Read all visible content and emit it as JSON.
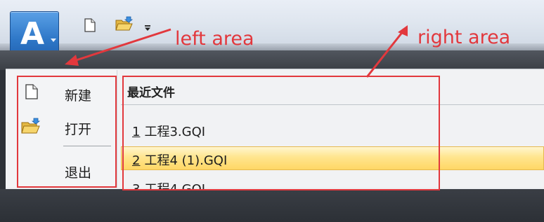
{
  "app": {
    "button_letter": "A"
  },
  "quick_access": {
    "icons": [
      "new-document-icon",
      "open-folder-icon",
      "customize-dropdown-icon"
    ]
  },
  "menu": {
    "items": [
      {
        "label": "新建",
        "icon": "new-document-icon"
      },
      {
        "label": "打开",
        "icon": "open-folder-icon"
      },
      {
        "label": "退出",
        "icon": ""
      }
    ]
  },
  "recent": {
    "header": "最近文件",
    "items": [
      {
        "num": "1",
        "name": "工程3.GQI",
        "selected": false
      },
      {
        "num": "2",
        "name": "工程4 (1).GQI",
        "selected": true
      },
      {
        "num": "3",
        "name": "工程4.GQI",
        "selected": false
      }
    ]
  },
  "annotations": {
    "left_label": "left area",
    "right_label": "right area",
    "color": "#e2383d"
  },
  "colors": {
    "selection": "#ffe58e",
    "app_button": "#2f78c8"
  }
}
